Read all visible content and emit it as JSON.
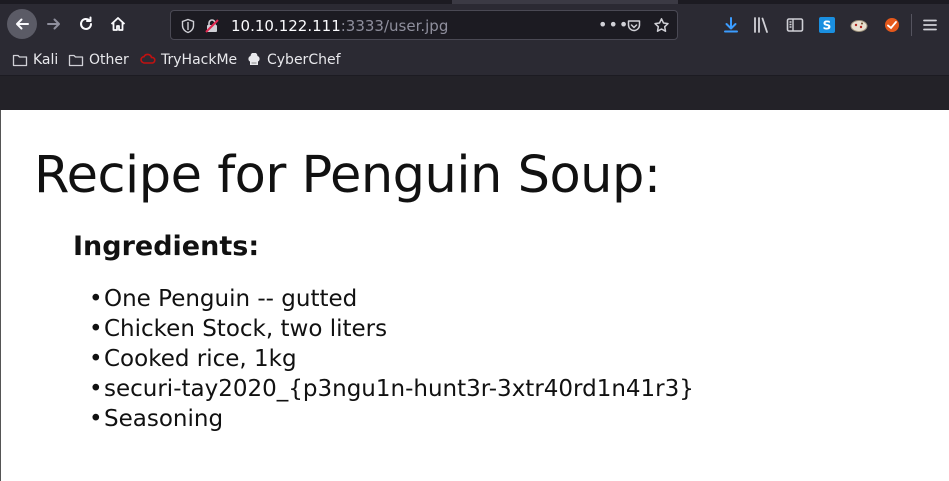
{
  "browser": {
    "url": {
      "host": "10.10.122.111",
      "rest": ":3333/user.jpg"
    },
    "bookmarks": [
      {
        "label": "Kali",
        "icon": "folder-icon"
      },
      {
        "label": "Other",
        "icon": "folder-icon"
      },
      {
        "label": "TryHackMe",
        "icon": "tryhackme-icon"
      },
      {
        "label": "CyberChef",
        "icon": "cyberchef-icon"
      }
    ],
    "colors": {
      "chrome": "#2b2a33",
      "urlbar": "#1c1b22",
      "accent_download": "#3b9cff"
    }
  },
  "page": {
    "title": "Recipe for Penguin Soup:",
    "subtitle": "Ingredients:",
    "bullet": "•",
    "items": [
      "One Penguin -- gutted",
      "Chicken Stock, two liters",
      "Cooked rice, 1kg",
      "securi-tay2020_{p3ngu1n-hunt3r-3xtr40rd1n41r3}",
      "Seasoning"
    ]
  }
}
